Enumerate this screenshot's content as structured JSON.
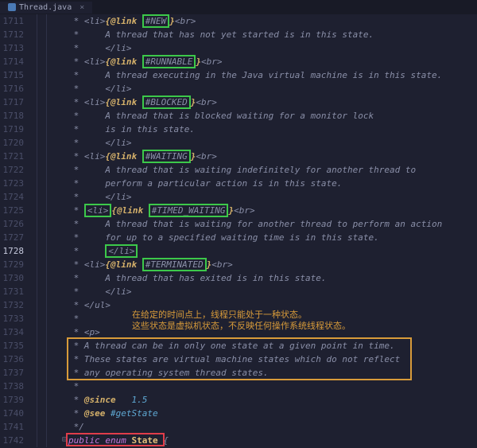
{
  "tab": {
    "name": "Thread.java",
    "close": "×"
  },
  "gutter": {
    "start": 1711,
    "end": 1742,
    "current": 1728
  },
  "lines": {
    "l1711": {
      "pre": " * <li>",
      "tag": "{@link ",
      "state": "#NEW",
      "post": "}<br>"
    },
    "l1712": " *     A thread that has not yet started is in this state.",
    "l1713": " *     </li>",
    "l1714": {
      "pre": " * <li>",
      "tag": "{@link ",
      "state": "#RUNNABLE",
      "post": "}<br>"
    },
    "l1715": " *     A thread executing in the Java virtual machine is in this state.",
    "l1716": " *     </li>",
    "l1717": {
      "pre": " * <li>",
      "tag": "{@link ",
      "state": "#BLOCKED",
      "post": "}<br>"
    },
    "l1718": " *     A thread that is blocked waiting for a monitor lock",
    "l1719": " *     is in this state.",
    "l1720": " *     </li>",
    "l1721": {
      "pre": " * <li>",
      "tag": "{@link ",
      "state": "#WAITING",
      "post": "}<br>"
    },
    "l1722": " *     A thread that is waiting indefinitely for another thread to",
    "l1723": " *     perform a particular action is in this state.",
    "l1724": " *     </li>",
    "l1725": {
      "pre": " * ",
      "litag": "<li>",
      "tag": "{@link ",
      "state": "#TIMED_WAITING",
      "post": "}<br>"
    },
    "l1726": " *     A thread that is waiting for another thread to perform an action",
    "l1727": " *     for up to a specified waiting time is in this state.",
    "l1728": {
      "pre": " *     ",
      "litag": "</li>"
    },
    "l1729": {
      "pre": " * <li>",
      "tag": "{@link ",
      "state": "#TERMINATED",
      "post": "}<br>"
    },
    "l1730": " *     A thread that has exited is in this state.",
    "l1731": " *     </li>",
    "l1732": " * </ul>",
    "l1733": " *",
    "l1734": " * <p>",
    "l1735": " * A thread can be in only one state at a given point in time.",
    "l1736": " * These states are virtual machine states which do not reflect",
    "l1737": " * any operating system thread states.",
    "l1738": " *",
    "l1739": {
      "pre": " * ",
      "tag": "@since",
      "val": "   1.5"
    },
    "l1740": {
      "pre": " * ",
      "tag": "@see ",
      "val": "#getState"
    },
    "l1741": " */",
    "l1742": {
      "pub": "public ",
      "enum": "enum ",
      "name": "State",
      "brace": " {"
    }
  },
  "annotation": {
    "line1": "在给定的时间点上，线程只能处于一种状态。",
    "line2": "这些状态是虚拟机状态，不反映任何操作系统线程状态。"
  }
}
